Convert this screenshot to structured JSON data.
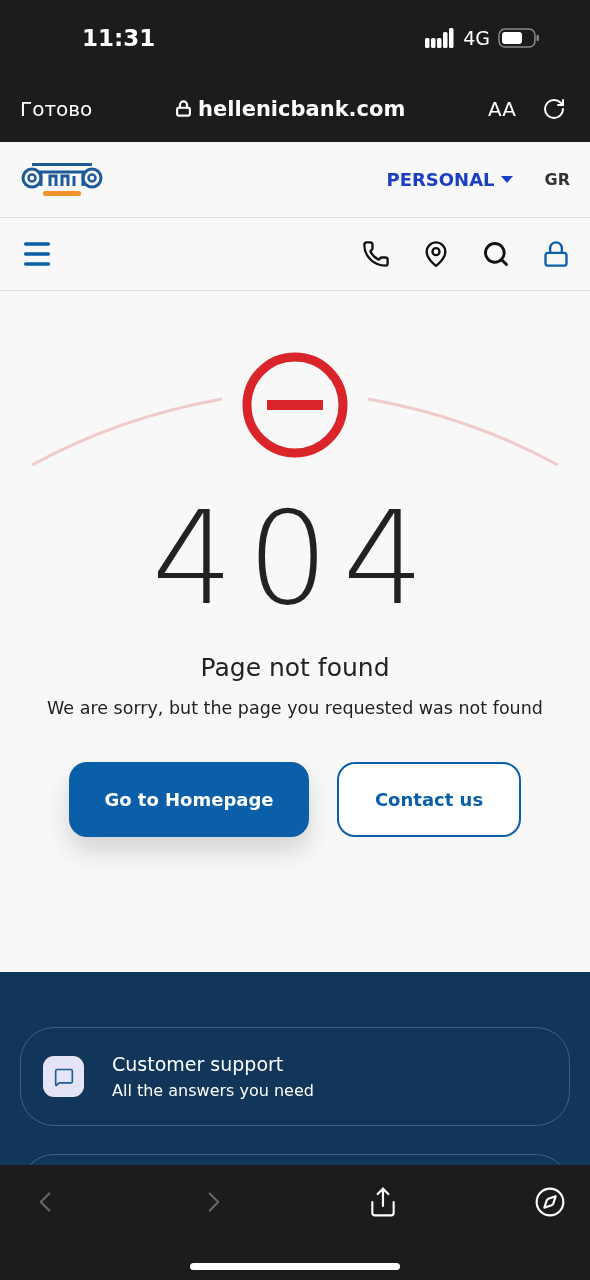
{
  "status_bar": {
    "time": "11:31",
    "network": "4G"
  },
  "browser_bar": {
    "done": "Готово",
    "address": "hellenicbank.com",
    "text_size": "AA"
  },
  "header": {
    "segment": "PERSONAL",
    "language": "GR"
  },
  "error": {
    "code": "404",
    "title": "Page not found",
    "message": "We are sorry, but the page you requested was not found"
  },
  "buttons": [
    {
      "label": "Go to Homepage",
      "kind": "primary"
    },
    {
      "label": "Contact us",
      "kind": "outline"
    }
  ],
  "footer_cards": [
    {
      "title": "Customer support",
      "subtitle": "All the answers you need"
    }
  ],
  "toolbar": {
    "back_disabled": true,
    "forward_disabled": true
  }
}
